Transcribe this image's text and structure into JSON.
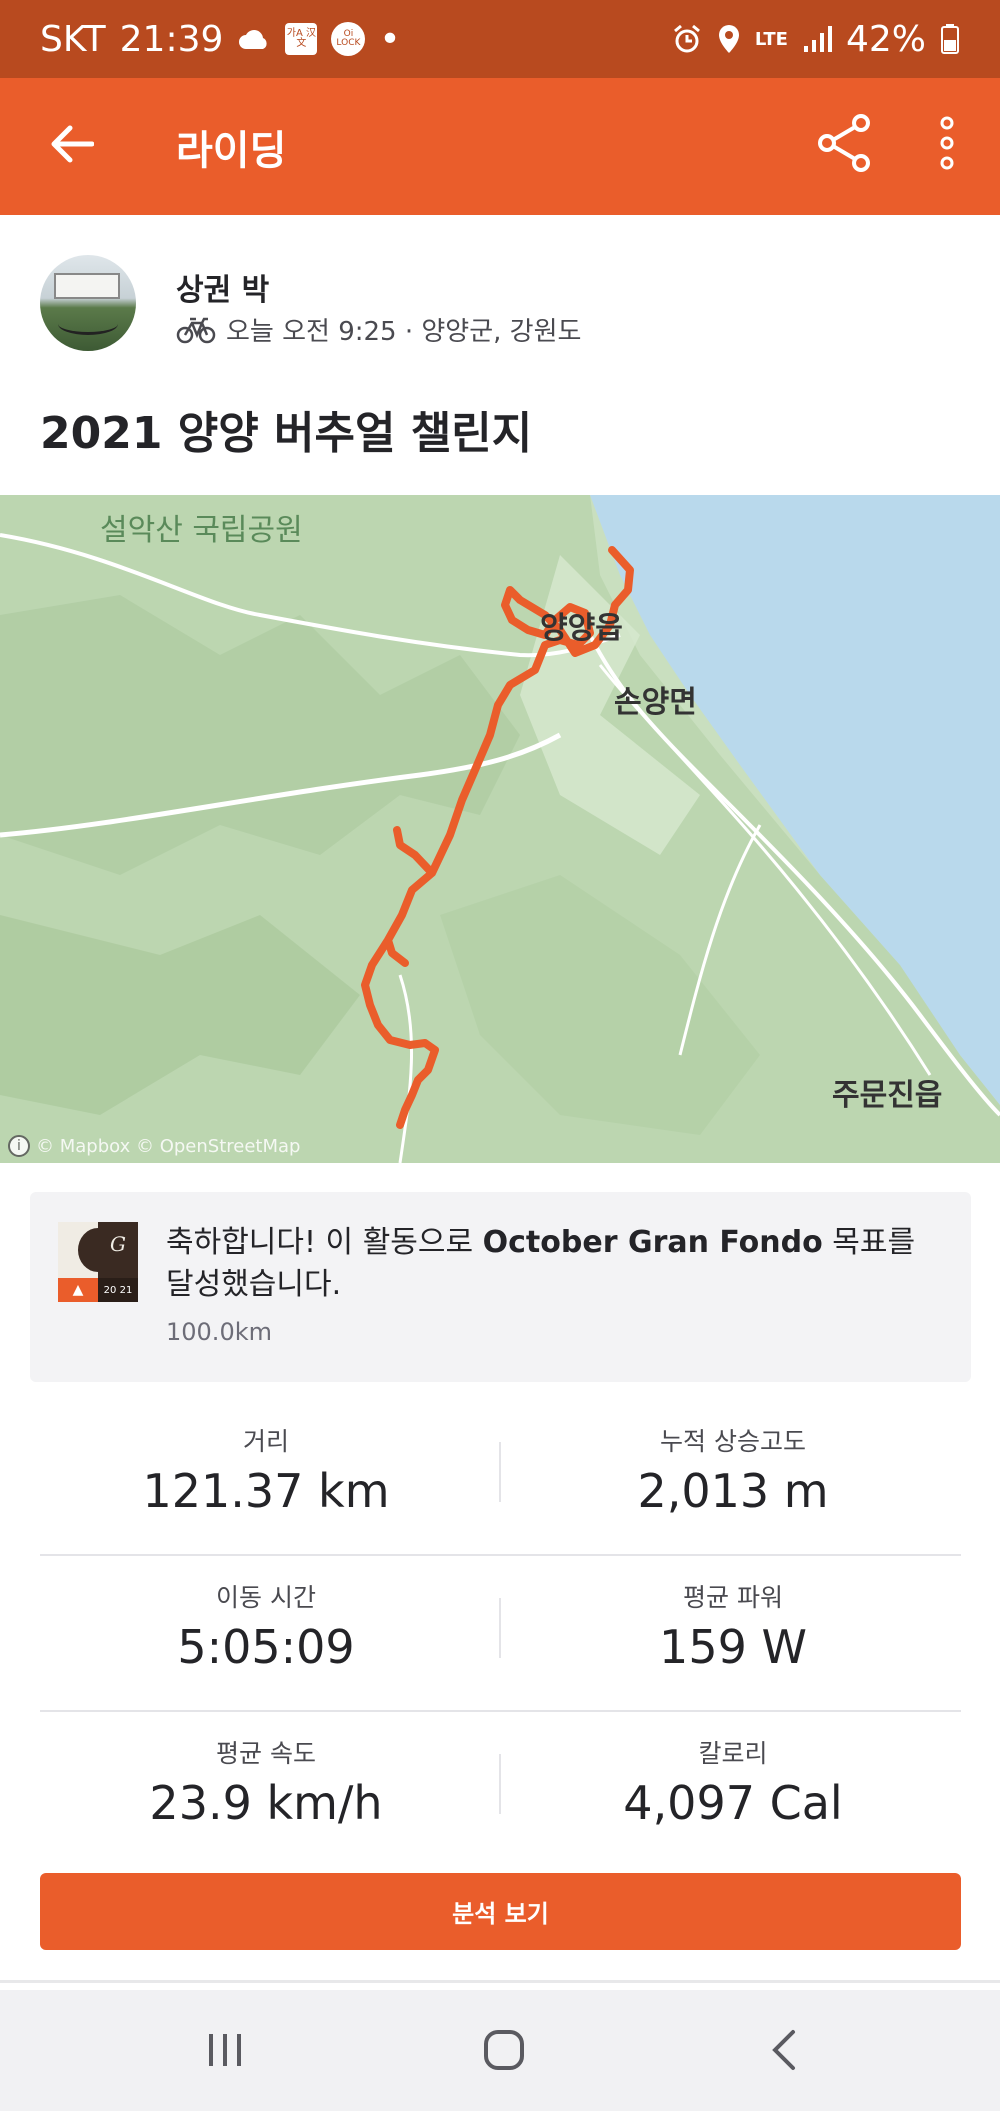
{
  "status_bar": {
    "carrier": "SKT",
    "time": "21:39",
    "chip_text": "가A 汉文",
    "circle_text": "Oi LOCK",
    "dot": "•",
    "network": "LTE",
    "battery": "42%"
  },
  "app_bar": {
    "title": "라이딩"
  },
  "athlete": {
    "name": "상권 박",
    "meta": "오늘 오전 9:25 · 양양군, 강원도"
  },
  "activity": {
    "title": "2021 양양 버추얼 챌린지"
  },
  "map": {
    "labels": {
      "park": "설악산 국립공원",
      "town": "양양읍",
      "district": "손양면",
      "south_town": "주문진읍"
    },
    "credit": "© Mapbox © OpenStreetMap",
    "route_color": "#ea5d2b"
  },
  "achievement": {
    "text_prefix": "축하합니다! 이 활동으로 ",
    "challenge": "October Gran Fondo",
    "text_suffix": " 목표를 달성했습니다.",
    "goal": "100.0km",
    "badge_year": "20 21"
  },
  "stats": [
    {
      "left_label": "거리",
      "left_value": "121.37 km",
      "right_label": "누적 상승고도",
      "right_value": "2,013 m"
    },
    {
      "left_label": "이동 시간",
      "left_value": "5:05:09",
      "right_label": "평균 파워",
      "right_value": "159 W"
    },
    {
      "left_label": "평균 속도",
      "left_value": "23.9 km/h",
      "right_label": "칼로리",
      "right_value": "4,097 Cal"
    }
  ],
  "analysis_button": "분석 보기",
  "colors": {
    "brand": "#ea5d2b",
    "status_bar": "#b84a1f"
  },
  "icons": [
    "back-arrow-icon",
    "share-icon",
    "more-vert-icon",
    "bike-icon",
    "recent-apps-icon",
    "home-icon",
    "nav-back-icon"
  ]
}
